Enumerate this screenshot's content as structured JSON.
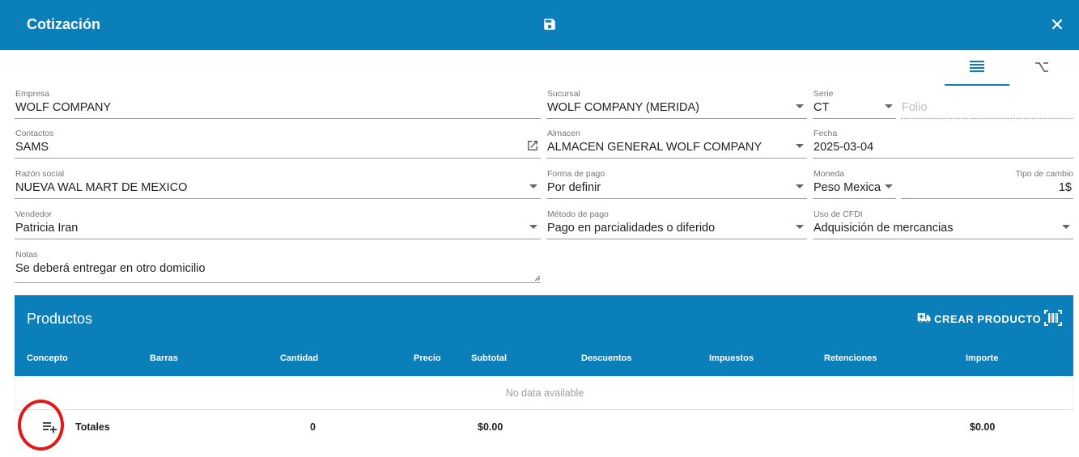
{
  "header": {
    "title": "Cotización",
    "save_icon": "save-icon",
    "close_icon": "close-icon"
  },
  "view_tabs": [
    {
      "icon": "list-icon",
      "active": true
    },
    {
      "icon": "option-icon",
      "active": false
    }
  ],
  "form": {
    "empresa": {
      "label": "Empresa",
      "value": "WOLF COMPANY"
    },
    "sucursal": {
      "label": "Sucursal",
      "value": "WOLF COMPANY (MERIDA)"
    },
    "serie": {
      "label": "Serie",
      "value": "CT"
    },
    "folio": {
      "placeholder": "Folio"
    },
    "contactos": {
      "label": "Contactos",
      "value": "SAMS"
    },
    "almacen": {
      "label": "Almacen",
      "value": "ALMACEN GENERAL WOLF COMPANY"
    },
    "fecha": {
      "label": "Fecha",
      "value": "2025-03-04"
    },
    "razon_social": {
      "label": "Razón social",
      "value": "NUEVA WAL MART DE MEXICO"
    },
    "forma_pago": {
      "label": "Forma de pago",
      "value": "Por definir"
    },
    "moneda": {
      "label": "Moneda",
      "value": "Peso Mexica"
    },
    "tipo_cambio": {
      "label": "Tipo de cambio",
      "value": "1$"
    },
    "vendedor": {
      "label": "Vendedor",
      "value": "Patricia Iran"
    },
    "metodo_pago": {
      "label": "Método de pago",
      "value": "Pago en parcialidades o diferido"
    },
    "uso_cfdi": {
      "label": "Uso de CFDI",
      "value": "Adquisición de mercancias"
    },
    "notas": {
      "label": "Notas",
      "value": "Se deberá entregar en otro domicilio"
    }
  },
  "products": {
    "title": "Productos",
    "create_button": "CREAR PRODUCTO",
    "create_icon": "truck-plus-icon",
    "barcode_icon": "barcode-scan-icon",
    "columns": [
      "Concepto",
      "Barras",
      "Cantidad",
      "Precio",
      "Subtotal",
      "Descuentos",
      "Impuestos",
      "Retenciones",
      "Importe"
    ],
    "empty_text": "No data available",
    "totals": {
      "label": "Totales",
      "cantidad": "0",
      "subtotal": "$0.00",
      "importe": "$0.00"
    },
    "add_row_icon": "playlist-add-icon"
  },
  "colors": {
    "primary": "#0a7fb9",
    "highlight": "#e01818"
  }
}
